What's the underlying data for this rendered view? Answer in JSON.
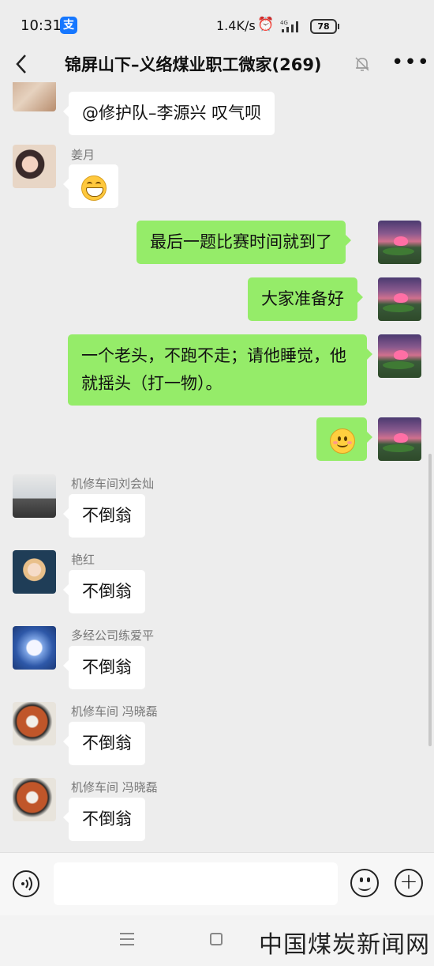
{
  "status_bar": {
    "time": "10:31",
    "alipay_glyph": "支",
    "speed": "1.4K/s",
    "alarm_icon": "⏰",
    "network": "4G",
    "battery": "78"
  },
  "header": {
    "back_icon": "chevron-left-icon",
    "title": "锦屏山下–义络煤业职工微家(269)",
    "more": "•••"
  },
  "messages": [
    {
      "side": "left",
      "sender": "",
      "text": "@修护队–李源兴  叹气呗"
    },
    {
      "side": "left",
      "sender": "姜月",
      "emoji": "grin"
    },
    {
      "side": "right",
      "text": "最后一题比赛时间就到了"
    },
    {
      "side": "right",
      "text": "大家准备好"
    },
    {
      "side": "right",
      "text_lines": [
        "一个老头，不跑不走；请他睡觉，他",
        "就摇头（打一物）。"
      ]
    },
    {
      "side": "right",
      "emoji": "smile"
    },
    {
      "side": "left",
      "sender": "机修车间刘会灿",
      "text": "不倒翁"
    },
    {
      "side": "left",
      "sender": "艳红",
      "text": "不倒翁"
    },
    {
      "side": "left",
      "sender": "多经公司练爱平",
      "text": "不倒翁"
    },
    {
      "side": "left",
      "sender": "机修车间 冯晓磊",
      "text": "不倒翁"
    },
    {
      "side": "left",
      "sender": "机修车间 冯晓磊",
      "text": "不倒翁"
    }
  ],
  "input_bar": {
    "voice_icon": "voice-icon",
    "placeholder": "",
    "emoji_icon": "emoji-icon",
    "plus_icon": "plus-icon",
    "plus": "+"
  },
  "nav_bar": {
    "menu_icon": "menu-icon",
    "home_icon": "home-square-icon"
  },
  "watermark": "中国煤炭新闻网",
  "colors": {
    "background": "#ededed",
    "my_bubble": "#95ec69",
    "other_bubble": "#ffffff",
    "sender_name": "#777777"
  }
}
